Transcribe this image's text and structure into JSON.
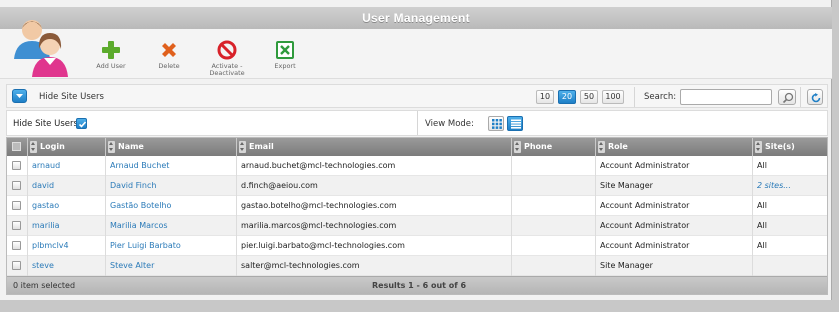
{
  "window": {
    "title": "User Management"
  },
  "toolbar": {
    "add_user": "Add User",
    "delete": "Delete",
    "activate_line1": "Activate -",
    "activate_line2": "Deactivate",
    "export": "Export"
  },
  "filterbar": {
    "hide_site_users": "Hide Site Users",
    "page_sizes": [
      "10",
      "20",
      "50",
      "100"
    ],
    "active_page_size": "20",
    "search_label": "Search:",
    "search_value": ""
  },
  "options": {
    "hide_site_users_label": "Hide Site Users",
    "hide_site_users_checked": true,
    "view_mode_label": "View Mode:",
    "view_mode_active": "list"
  },
  "grid": {
    "columns": [
      "Login",
      "Name",
      "Email",
      "Phone",
      "Role",
      "Site(s)"
    ],
    "rows": [
      {
        "login": "arnaud",
        "name": "Arnaud Buchet",
        "email": "arnaud.buchet@mcl-technologies.com",
        "phone": "",
        "role": "Account Administrator",
        "sites": "All"
      },
      {
        "login": "david",
        "name": "David Finch",
        "email": "d.finch@aeiou.com",
        "phone": "",
        "role": "Site Manager",
        "sites": "2 sites..."
      },
      {
        "login": "gastao",
        "name": "Gastão Botelho",
        "email": "gastao.botelho@mcl-technologies.com",
        "phone": "",
        "role": "Account Administrator",
        "sites": "All"
      },
      {
        "login": "marilia",
        "name": "Marilia Marcos",
        "email": "marilia.marcos@mcl-technologies.com",
        "phone": "",
        "role": "Account Administrator",
        "sites": "All"
      },
      {
        "login": "plbmclv4",
        "name": "Pier Luigi Barbato",
        "email": "pier.luigi.barbato@mcl-technologies.com",
        "phone": "",
        "role": "Account Administrator",
        "sites": "All"
      },
      {
        "login": "steve",
        "name": "Steve Alter",
        "email": "salter@mcl-technologies.com",
        "phone": "",
        "role": "Site Manager",
        "sites": ""
      }
    ],
    "footer": {
      "selected": "0 item selected",
      "results": "Results 1 - 6 out of 6"
    }
  },
  "colors": {
    "accent_blue": "#1e7fc6",
    "link_blue": "#2a7ab8",
    "header_gray": "#8a8a8a"
  }
}
